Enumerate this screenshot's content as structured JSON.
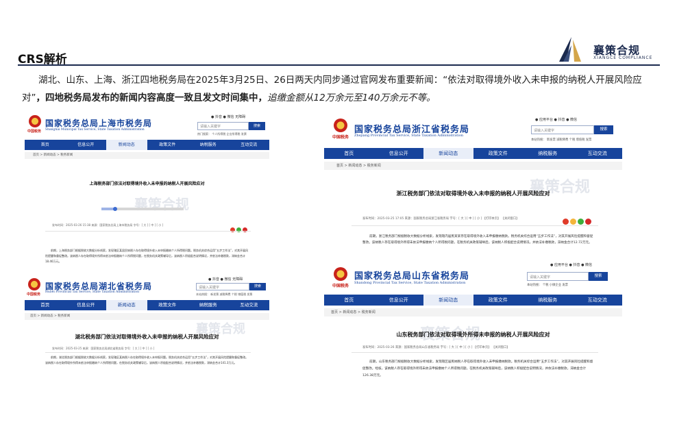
{
  "header": {
    "title": "CRS解析",
    "logo_name": "襄策合规",
    "logo_en": "XIANGCE COMPLIANCE"
  },
  "intro": {
    "p1": "湖北、山东、上海、浙江四地税务局在2025年3月25日、26日两天内同步通过官网发布重要新闻：“依法对取得境外收入未申报的纳税人开展风险应对”",
    "p2": "，四地税务局发布的新闻内容高度一致且发文时间集中，",
    "p3": "追缴金额从12万余元至140万余元不等。"
  },
  "common": {
    "seal": "中国税务",
    "search_placeholder": "请输入关键字",
    "search_button": "搜索",
    "nav": [
      "首页",
      "信息公开",
      "新闻动态",
      "政策文件",
      "纳税服务",
      "互动交流"
    ],
    "tools_lr": "● 抖音  ● 微信  无障碍",
    "tools_lr2": "● 应用平台  ● 抖音  ● 微信",
    "hot_sh": "热门搜索：  个人所得税  企业所得税  发票",
    "hot_zj": "本站热搜：  新发票  减税降费  个税  增值税  发票",
    "hot_sd": "本站热搜：  个税  小微企业  发票",
    "watermark": "襄策合规"
  },
  "sh": {
    "name": "国家税务总局上海市税务局",
    "name_en": "Shanghai Municipal Tax Service, State Taxation Administration",
    "crumb": "首页 > 新闻动态 > 税务新闻",
    "title": "上海税务部门依法对取得境外收入未申报的纳税人开展风险应对",
    "meta": "发布时间：2025-03-26 15:38    来源：国家税务总局上海市税务局    字号：[ 大 ] [ 中 ] [ 小 ]",
    "body": "前期，上海税务部门根据税收大数据分析线索，发现辖区某居民纳税人存在取得境外收入未申报缴纳个人所得税问题。税务机关综合运用“五步工作法”，对其开展风险提醒和督促整改。该纳税人存在取得境外所得未依法申报缴纳个人所得税问题，在税务机关政策辅导后，该纳税人积极配合说明情况，并依法补缴税款，滞纳金合计18.46万元。"
  },
  "zj": {
    "name": "国家税务总局浙江省税务局",
    "name_en": "Zhejiang Provincial Tax Service, State Taxation Administration",
    "crumb": "首页 > 新闻动态 > 税务新闻",
    "title": "浙江税务部门依法对取得境外收入未申报的纳税人开展风险应对",
    "meta": "发布时间：2025-03-25 17:05    来源：国家税务总局浙江省税务局    字号：[ 大 ] [ 中 ] [ 小 ]    【打印本页】    【关闭窗口】",
    "body": "前期，浙江税务部门根据税收大数据分析线索，发现辖内居民某某存在取得境外收入未申报缴纳税款。税务机关综合运用“五步工作法”，对其开展风险提醒和督促整改。该纳税人存在取得境外所得未依法申报缴纳个人所得税问题，在税务机关政策辅导后，该纳税人积极配合说明情况，并依法补缴税款，滞纳金合计12.72万元。"
  },
  "hb": {
    "name": "国家税务总局湖北省税务局",
    "name_en": "Hubei Provincial Tax Service, State Taxation Administration",
    "crumb": "首页 > 新闻动态 > 税务新闻",
    "title": "湖北税务部门依法对取得境外收入未申报的纳税人开展风险应对",
    "meta": "发布时间：2025-03-25    来源：国家税务总局湖北省税务局    字号：[ 大 ] [ 中 ] [ 小 ]",
    "body": "前期，湖北税务部门根据税收大数据分析线索，发现辖区某纳税人存在取得境外收入未申报问题。税务机关综合运用“五步工作法”，对其开展风险提醒和督促整改。该纳税人存在取得境外所得未依法申报缴纳个人所得税问题，在税务机关政策辅导后，该纳税人积极配合说明情况，并依法补缴税款，滞纳金合计141.3万元。"
  },
  "sd": {
    "name": "国家税务总局山东省税务局",
    "name_en": "Shandong Provincial Tax Service, State Taxation Administration",
    "crumb": "首页 > 新闻动态 > 税务新闻",
    "title": "山东税务部门依法对取得境外所得未申报的纳税人开展风险应对",
    "meta": "发布时间：2025-03-26    来源：国家税务总局山东省税务局    字号：[ 大 ] [ 中 ] [ 小 ]    【打印本页】    【关闭窗口】",
    "body": "前期，山东税务部门根据税收大数据分析线索，发现辖区居民纳税人存在取得境外收入未申报缴纳税款。税务机关综合运用“五步工作法”，对其开展风险提醒和督促整改。经核，该纳税人存在取得境外所得未依法申报缴纳个人所得税问题，在税务机关政策辅导后，该纳税人积极配合说明情况，并依法补缴税款，滞纳金合计126.38万元。"
  }
}
